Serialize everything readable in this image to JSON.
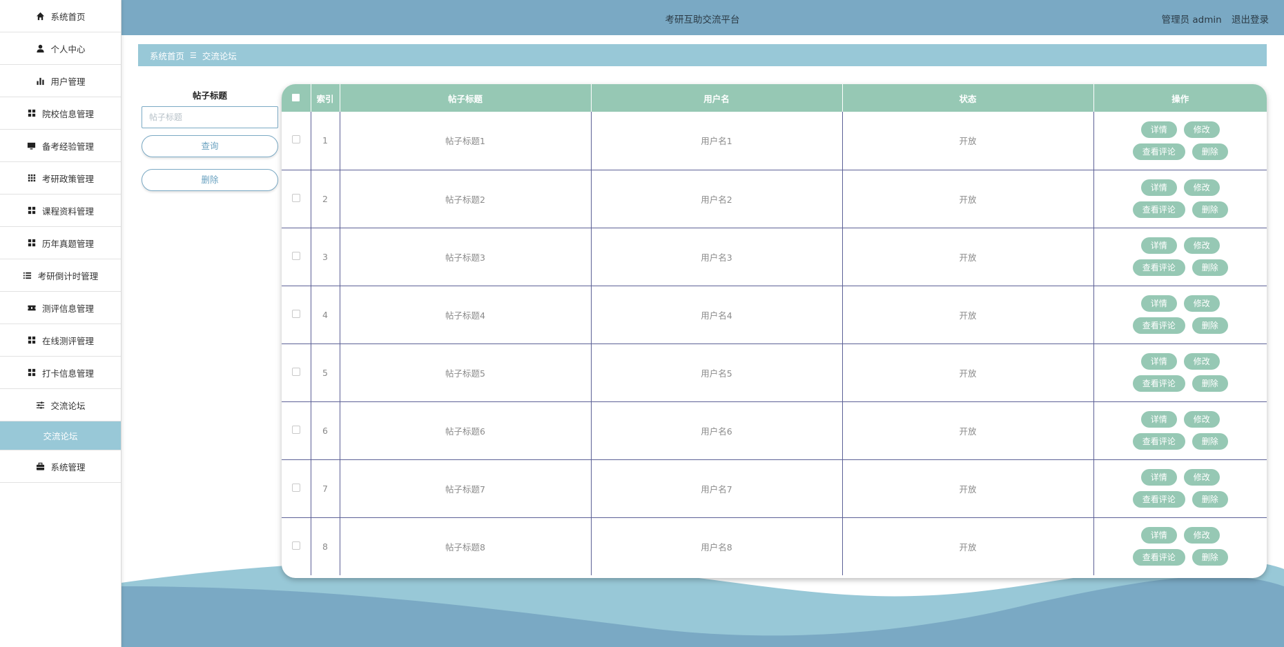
{
  "sidebar": {
    "items": [
      {
        "label": "系统首页",
        "icon": "home-icon"
      },
      {
        "label": "个人中心",
        "icon": "user-icon"
      },
      {
        "label": "用户管理",
        "icon": "bar-chart-icon"
      },
      {
        "label": "院校信息管理",
        "icon": "grid-icon"
      },
      {
        "label": "备考经验管理",
        "icon": "monitor-icon"
      },
      {
        "label": "考研政策管理",
        "icon": "apps-icon"
      },
      {
        "label": "课程资料管理",
        "icon": "grid-icon"
      },
      {
        "label": "历年真题管理",
        "icon": "grid-icon"
      },
      {
        "label": "考研倒计时管理",
        "icon": "list-icon"
      },
      {
        "label": "测评信息管理",
        "icon": "ticket-icon"
      },
      {
        "label": "在线测评管理",
        "icon": "grid-icon"
      },
      {
        "label": "打卡信息管理",
        "icon": "grid-icon"
      },
      {
        "label": "交流论坛",
        "icon": "sliders-icon"
      }
    ],
    "active_sub": "交流论坛",
    "last_item": {
      "label": "系统管理",
      "icon": "briefcase-icon"
    }
  },
  "header": {
    "title": "考研互助交流平台",
    "role": "管理员 admin",
    "logout": "退出登录"
  },
  "breadcrumb": {
    "home": "系统首页",
    "separator": "☰",
    "current": "交流论坛"
  },
  "search": {
    "label": "帖子标题",
    "placeholder": "帖子标题",
    "query_button": "查询",
    "delete_button": "删除"
  },
  "table": {
    "columns": [
      "索引",
      "帖子标题",
      "用户名",
      "状态",
      "操作"
    ],
    "rows": [
      {
        "index": "1",
        "title": "帖子标题1",
        "username": "用户名1",
        "status": "开放"
      },
      {
        "index": "2",
        "title": "帖子标题2",
        "username": "用户名2",
        "status": "开放"
      },
      {
        "index": "3",
        "title": "帖子标题3",
        "username": "用户名3",
        "status": "开放"
      },
      {
        "index": "4",
        "title": "帖子标题4",
        "username": "用户名4",
        "status": "开放"
      },
      {
        "index": "5",
        "title": "帖子标题5",
        "username": "用户名5",
        "status": "开放"
      },
      {
        "index": "6",
        "title": "帖子标题6",
        "username": "用户名6",
        "status": "开放"
      },
      {
        "index": "7",
        "title": "帖子标题7",
        "username": "用户名7",
        "status": "开放"
      },
      {
        "index": "8",
        "title": "帖子标题8",
        "username": "用户名8",
        "status": "开放"
      }
    ],
    "actions": {
      "detail": "详情",
      "edit": "修改",
      "comments": "查看评论",
      "delete": "删除"
    }
  },
  "colors": {
    "header_bg": "#7aa9c4",
    "accent_light": "#98c8d7",
    "table_header": "#96c8b4",
    "grid_line": "#5b5f95"
  }
}
